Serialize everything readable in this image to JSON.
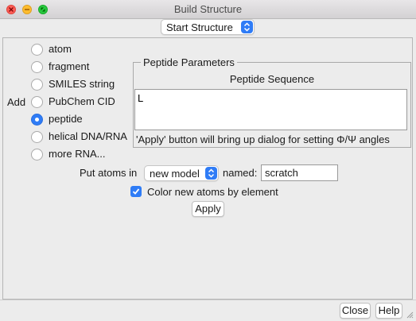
{
  "window": {
    "title": "Build Structure"
  },
  "top": {
    "structure_menu": "Start Structure"
  },
  "add": {
    "label": "Add",
    "options": [
      {
        "label": "atom",
        "selected": false
      },
      {
        "label": "fragment",
        "selected": false
      },
      {
        "label": "SMILES string",
        "selected": false
      },
      {
        "label": "PubChem CID",
        "selected": false
      },
      {
        "label": "peptide",
        "selected": true
      },
      {
        "label": "helical DNA/RNA",
        "selected": false
      },
      {
        "label": "more RNA...",
        "selected": false
      }
    ]
  },
  "peptide": {
    "group_title": "Peptide Parameters",
    "sequence_header": "Peptide Sequence",
    "sequence_value": "L",
    "hint": "'Apply' button will bring up dialog for setting Φ/Ψ angles"
  },
  "put_atoms": {
    "label": "Put atoms in",
    "model_menu": "new model",
    "named_label": "named:",
    "name_value": "scratch"
  },
  "color_option": {
    "label": "Color new atoms by element",
    "checked": true
  },
  "buttons": {
    "apply": "Apply",
    "close": "Close",
    "help": "Help"
  },
  "colors": {
    "accent": "#2f7cf6",
    "window_bg": "#ececec"
  }
}
